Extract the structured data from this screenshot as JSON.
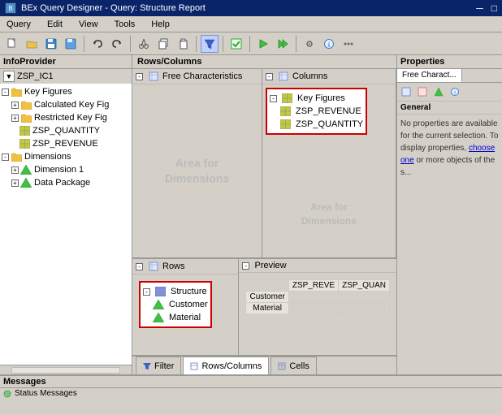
{
  "titleBar": {
    "icon": "BEx",
    "title": "BEx Query Designer - Query: Structure Report"
  },
  "menuBar": {
    "items": [
      "Query",
      "Edit",
      "View",
      "Tools",
      "Help"
    ]
  },
  "toolbar": {
    "buttons": [
      "new",
      "open",
      "save",
      "save-as",
      "sep",
      "undo",
      "redo",
      "sep",
      "cut",
      "copy",
      "paste",
      "sep",
      "filter",
      "check",
      "sep",
      "info",
      "sep",
      "execute",
      "sep",
      "settings",
      "export",
      "import",
      "sep",
      "help"
    ]
  },
  "infoProvider": {
    "header": "InfoProvider",
    "providerName": "ZSP_IC1",
    "tree": {
      "keyFigures": {
        "label": "Key Figures",
        "children": {
          "calculatedKF": "Calculated Key Fig",
          "restrictedKF": "Restricted Key Fig",
          "zspQuantity": "ZSP_QUANTITY",
          "zspRevenue": "ZSP_REVENUE"
        }
      },
      "dimensions": {
        "label": "Dimensions",
        "children": {
          "dim1": "Dimension 1",
          "dataPkg": "Data Package"
        }
      }
    }
  },
  "rowsColumns": {
    "header": "Rows/Columns",
    "freeChar": {
      "label": "Free Characteristics",
      "watermark": "Area for\nDimensions"
    },
    "columns": {
      "label": "Columns",
      "keyFigures": {
        "label": "Key Figures",
        "items": [
          "ZSP_REVENUE",
          "ZSP_QUANTITY"
        ]
      },
      "watermark": "Area for\nDimensions"
    },
    "rows": {
      "label": "Rows",
      "structure": {
        "label": "Structure",
        "items": [
          "Customer",
          "Material"
        ]
      },
      "watermark": ""
    },
    "preview": {
      "label": "Preview",
      "columns": [
        "ZSP_REVE",
        "ZSP_QUAN"
      ],
      "rows": [
        "Customer",
        "Material"
      ]
    }
  },
  "properties": {
    "header": "Properties",
    "tabs": [
      "Free Charact...",
      "General"
    ],
    "activeTab": "Free Charact...",
    "activeSubTab": "General",
    "message": "No properties are available for the current selection. To display properties, choose one or more objects of the s...",
    "chooseOne": "choose one"
  },
  "bottomTabs": [
    "Filter",
    "Rows/Columns",
    "Cells"
  ],
  "activeTab": "Rows/Columns",
  "messages": {
    "header": "Messages",
    "statusLabel": "Status Messages"
  }
}
